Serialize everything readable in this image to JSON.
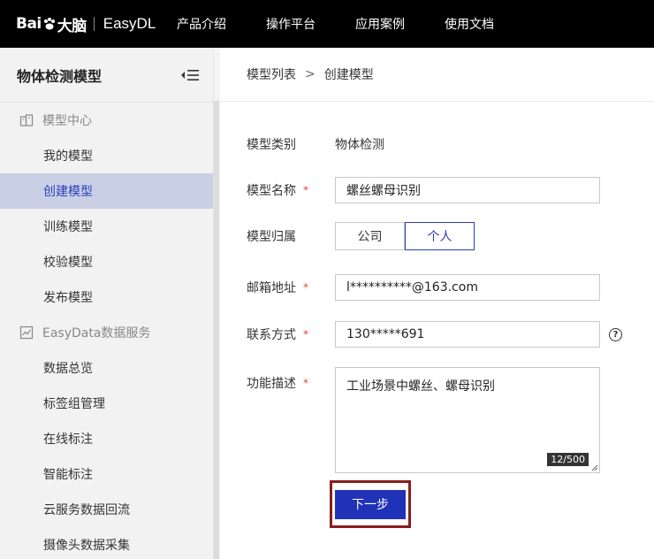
{
  "topbar": {
    "logo_text_a": "Bai",
    "logo_text_b": "大脑",
    "product": "EasyDL",
    "nav": [
      "产品介绍",
      "操作平台",
      "应用案例",
      "使用文档"
    ]
  },
  "sidebar": {
    "title": "物体检测模型",
    "groups": [
      {
        "label": "模型中心",
        "items": [
          "我的模型",
          "创建模型",
          "训练模型",
          "校验模型",
          "发布模型"
        ]
      },
      {
        "label": "EasyData数据服务",
        "items": [
          "数据总览",
          "标签组管理",
          "在线标注",
          "智能标注",
          "云服务数据回流",
          "摄像头数据采集"
        ]
      }
    ],
    "active_item": "创建模型"
  },
  "breadcrumb": {
    "parent": "模型列表",
    "separator": ">",
    "current": "创建模型"
  },
  "form": {
    "type_label": "模型类别",
    "type_value": "物体检测",
    "name_label": "模型名称",
    "name_value": "螺丝螺母识别",
    "owner_label": "模型归属",
    "owner_options": [
      "公司",
      "个人"
    ],
    "owner_selected": "个人",
    "email_label": "邮箱地址",
    "email_value": "l**********@163.com",
    "phone_label": "联系方式",
    "phone_value": "130*****691",
    "help_symbol": "?",
    "desc_label": "功能描述",
    "desc_value": "工业场景中螺丝、螺母识别",
    "desc_counter": "12/500",
    "required_mark": "*",
    "next_label": "下一步"
  },
  "colors": {
    "accent": "#2032b8",
    "active_bg": "#c9d0e6",
    "highlight_border": "#8a1d1d",
    "required": "#e0433c"
  }
}
